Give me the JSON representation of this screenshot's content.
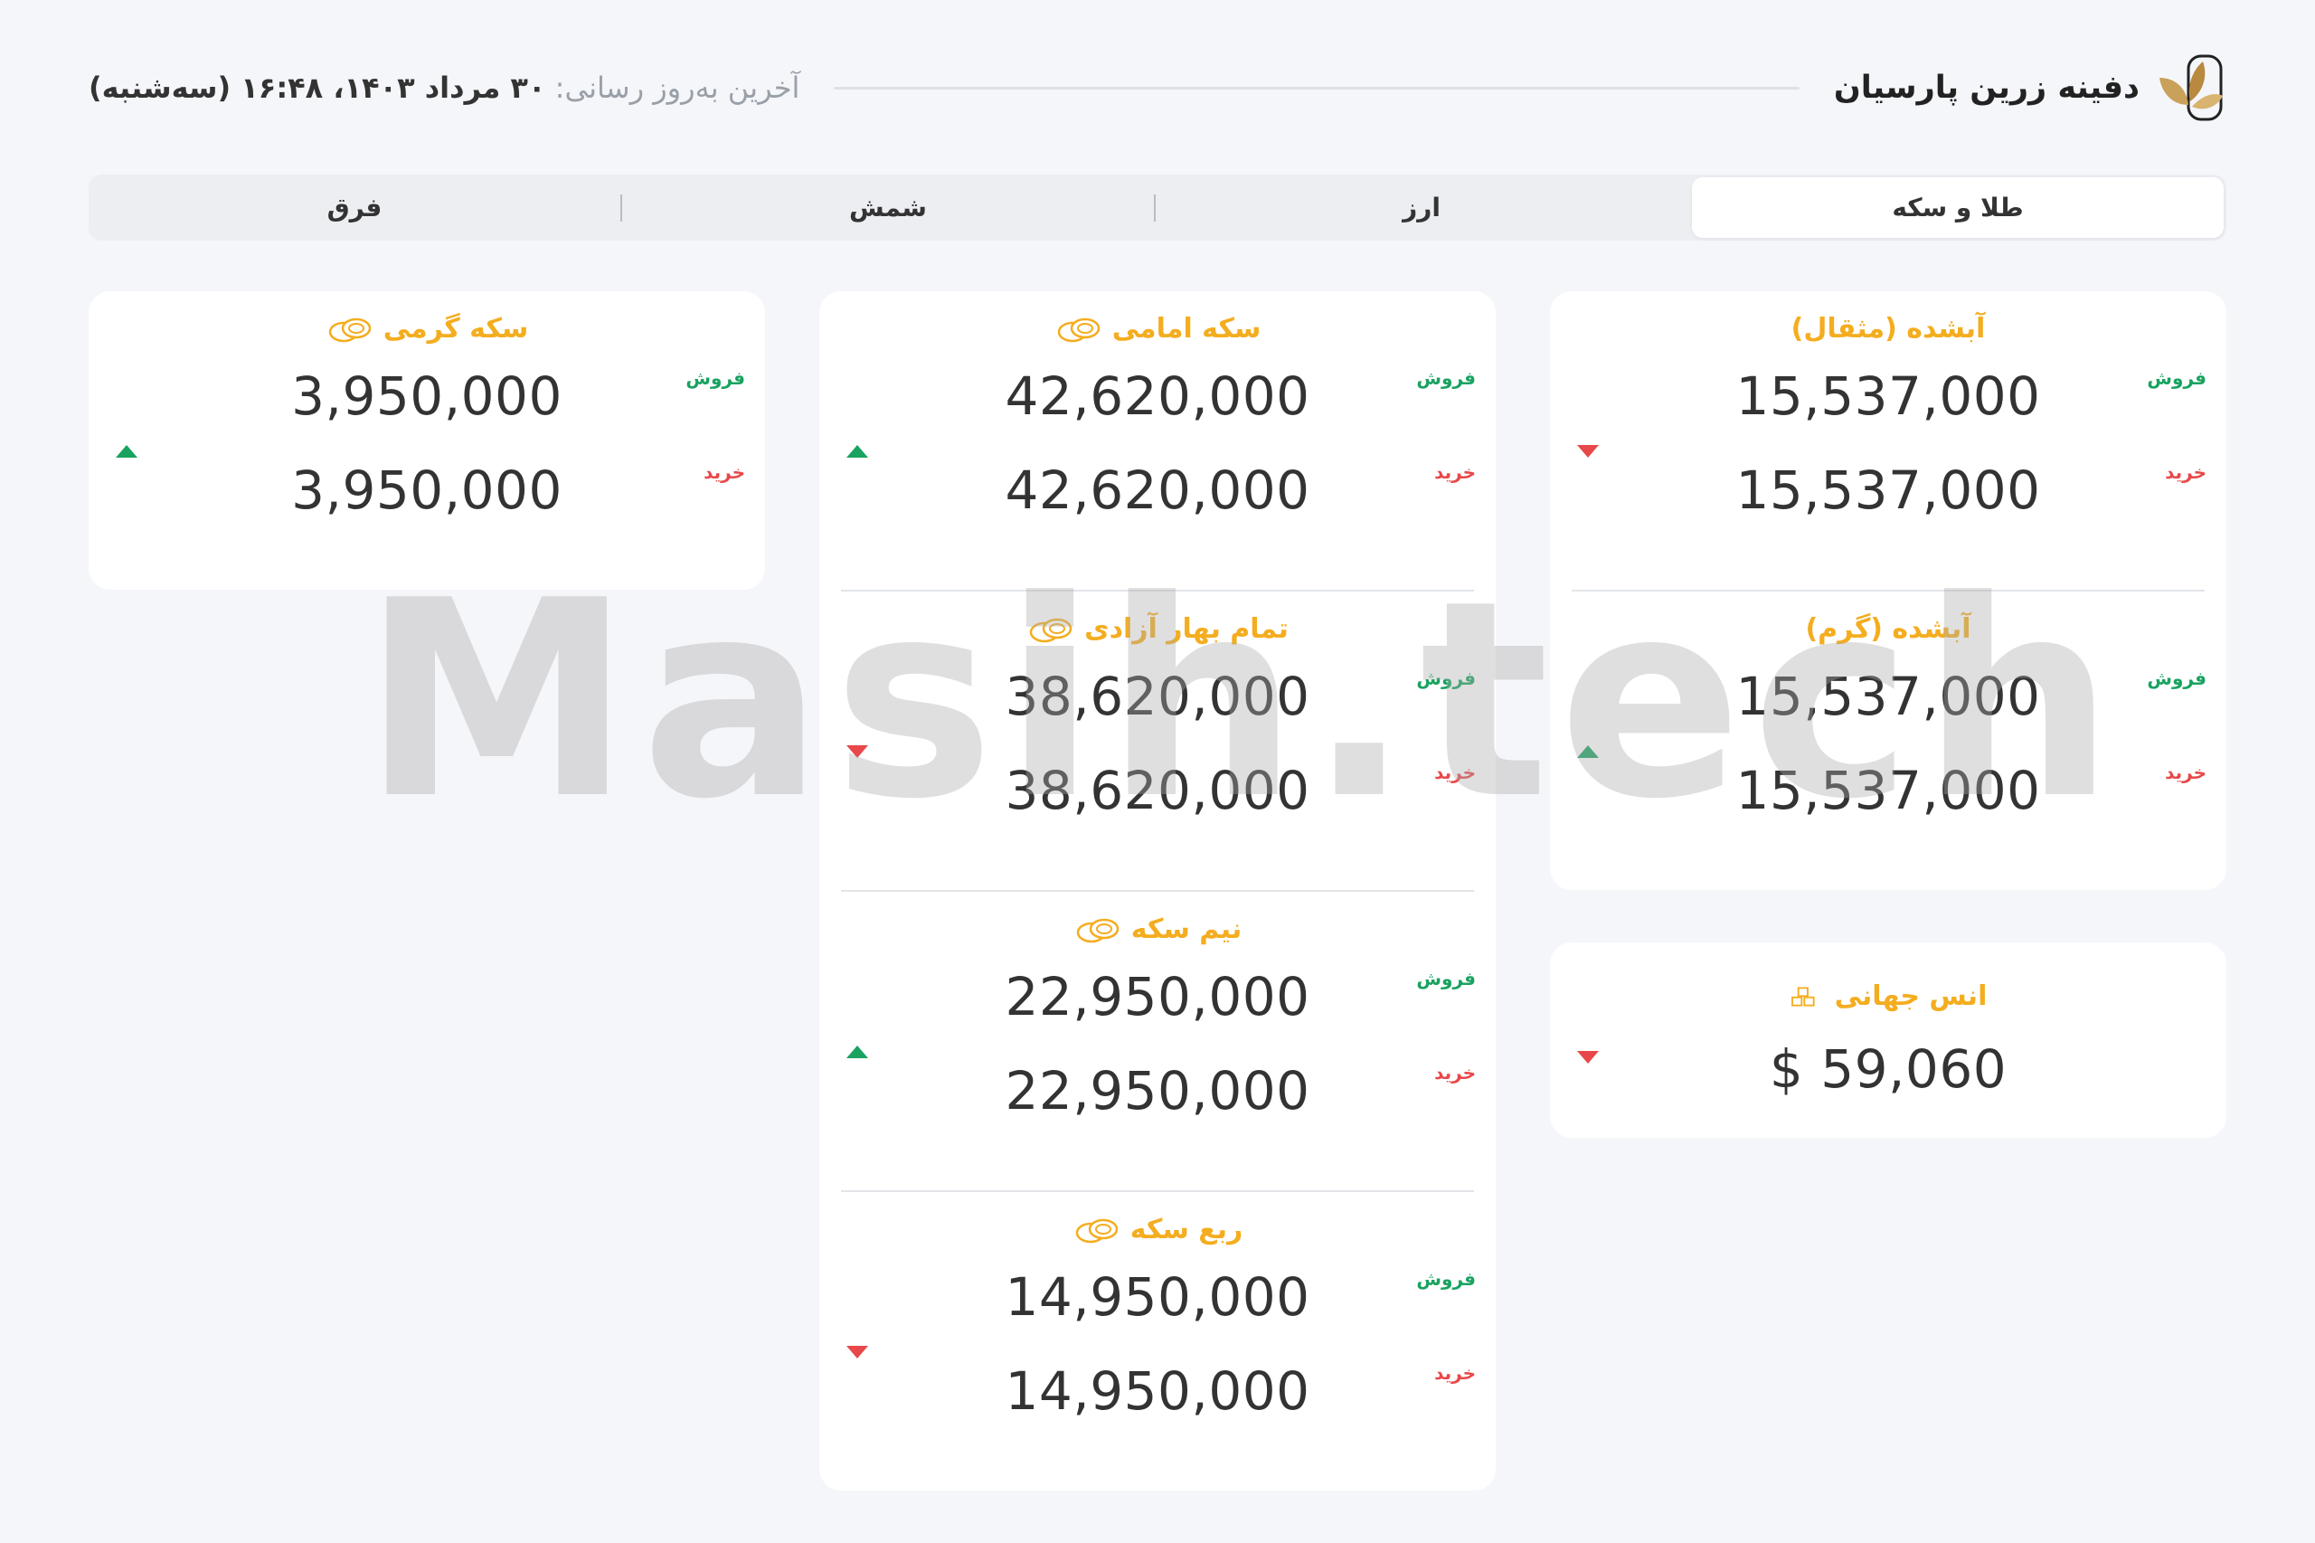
{
  "header": {
    "brand_name": "دفینه زرین پارسیان",
    "updated_label": "آخرین به‌روز رسانی:",
    "updated_value": "۳۰ مرداد ۱۴۰۳، ۱۶:۴۸ (سه‌شنبه)"
  },
  "tabs": [
    "طلا و سکه",
    "ارز",
    "شمش",
    "فرق"
  ],
  "labels": {
    "sell": "فروش",
    "buy": "خرید"
  },
  "colors": {
    "accent": "#f4ad1f",
    "up": "#1aa260",
    "down": "#e8484a"
  },
  "right_column": [
    {
      "title": "آبشده (مثقال)",
      "icon": "none",
      "sell": "15,537,000",
      "buy": "15,537,000",
      "trend": "down"
    },
    {
      "title": "آبشده (گرم)",
      "icon": "none",
      "sell": "15,537,000",
      "buy": "15,537,000",
      "trend": "up"
    }
  ],
  "ounce": {
    "title": "انس جهانی",
    "icon": "gold-bars-icon",
    "value": "$ 59,060",
    "trend": "down"
  },
  "middle_column": [
    {
      "title": "سکه امامی",
      "icon": "coins-icon",
      "sell": "42,620,000",
      "buy": "42,620,000",
      "trend": "up"
    },
    {
      "title": "تمام بهار آزادی",
      "icon": "coins-icon",
      "sell": "38,620,000",
      "buy": "38,620,000",
      "trend": "down"
    },
    {
      "title": "نیم سکه",
      "icon": "coins-icon",
      "sell": "22,950,000",
      "buy": "22,950,000",
      "trend": "up"
    },
    {
      "title": "ربع سکه",
      "icon": "coins-icon",
      "sell": "14,950,000",
      "buy": "14,950,000",
      "trend": "down"
    }
  ],
  "left_column": [
    {
      "title": "سکه گرمی",
      "icon": "coins-icon",
      "sell": "3,950,000",
      "buy": "3,950,000",
      "trend": "up"
    }
  ],
  "watermark": "Masih.tech"
}
